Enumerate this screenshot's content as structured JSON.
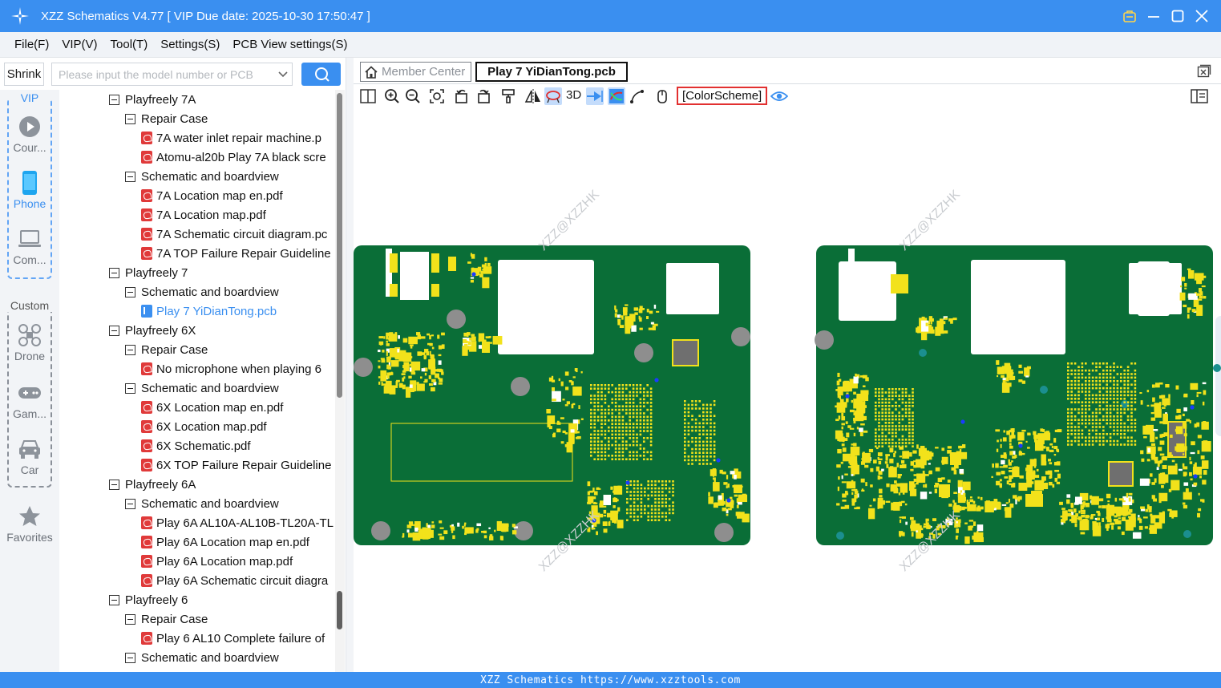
{
  "window": {
    "title": "XZZ Schematics V4.77 [ VIP Due date: 2025-10-30 17:50:47 ]"
  },
  "menu": [
    "File(F)",
    "VIP(V)",
    "Tool(T)",
    "Settings(S)",
    "PCB View settings(S)"
  ],
  "search": {
    "shrink_label": "Shrink",
    "placeholder": "Please input the model number or PCB"
  },
  "categories": {
    "vip_label": "VIP",
    "custom_label": "Custom",
    "vip_items": [
      "Cour...",
      "Phone",
      "Com..."
    ],
    "custom_items": [
      "Drone",
      "Gam...",
      "Car"
    ],
    "favorites": "Favorites"
  },
  "tree": [
    {
      "level": 0,
      "kind": "folder",
      "text": "Playfreely 7A"
    },
    {
      "level": 1,
      "kind": "folder",
      "text": "Repair Case"
    },
    {
      "level": 2,
      "kind": "pdf",
      "text": "7A water inlet repair machine.p"
    },
    {
      "level": 2,
      "kind": "pdf",
      "text": "Atomu-al20b Play 7A black scre"
    },
    {
      "level": 1,
      "kind": "folder",
      "text": "Schematic and boardview"
    },
    {
      "level": 2,
      "kind": "pdf",
      "text": "7A Location map en.pdf"
    },
    {
      "level": 2,
      "kind": "pdf",
      "text": "7A Location map.pdf"
    },
    {
      "level": 2,
      "kind": "pdf",
      "text": "7A Schematic circuit diagram.pc"
    },
    {
      "level": 2,
      "kind": "pdf",
      "text": "7A TOP Failure Repair Guideline"
    },
    {
      "level": 0,
      "kind": "folder",
      "text": "Playfreely 7"
    },
    {
      "level": 1,
      "kind": "folder",
      "text": "Schematic and boardview"
    },
    {
      "level": 2,
      "kind": "pcb",
      "text": "Play 7 YiDianTong.pcb",
      "selected": true
    },
    {
      "level": 0,
      "kind": "folder",
      "text": "Playfreely 6X"
    },
    {
      "level": 1,
      "kind": "folder",
      "text": "Repair Case"
    },
    {
      "level": 2,
      "kind": "pdf",
      "text": "No microphone when playing 6"
    },
    {
      "level": 1,
      "kind": "folder",
      "text": "Schematic and boardview"
    },
    {
      "level": 2,
      "kind": "pdf",
      "text": "6X Location map en.pdf"
    },
    {
      "level": 2,
      "kind": "pdf",
      "text": "6X Location map.pdf"
    },
    {
      "level": 2,
      "kind": "pdf",
      "text": "6X Schematic.pdf"
    },
    {
      "level": 2,
      "kind": "pdf",
      "text": "6X TOP Failure Repair Guideline"
    },
    {
      "level": 0,
      "kind": "folder",
      "text": "Playfreely 6A"
    },
    {
      "level": 1,
      "kind": "folder",
      "text": "Schematic and boardview"
    },
    {
      "level": 2,
      "kind": "pdf",
      "text": "Play 6A AL10A-AL10B-TL20A-TL"
    },
    {
      "level": 2,
      "kind": "pdf",
      "text": "Play 6A Location map en.pdf"
    },
    {
      "level": 2,
      "kind": "pdf",
      "text": "Play 6A Location map.pdf"
    },
    {
      "level": 2,
      "kind": "pdf",
      "text": "Play 6A Schematic circuit diagra"
    },
    {
      "level": 0,
      "kind": "folder",
      "text": "Playfreely 6"
    },
    {
      "level": 1,
      "kind": "folder",
      "text": "Repair Case"
    },
    {
      "level": 2,
      "kind": "pdf",
      "text": "Play 6 AL10 Complete failure of"
    },
    {
      "level": 1,
      "kind": "folder",
      "text": "Schematic and boardview"
    }
  ],
  "tabs": {
    "member": "Member Center",
    "active": "Play 7 YiDianTong.pcb"
  },
  "toolbar": {
    "three_d": "3D",
    "color_scheme": "[ColorScheme]"
  },
  "canvas": {
    "watermark": "XZZ@XZZHK",
    "board_color": "#0a6e37",
    "pad_color": "#f2e21b",
    "hole_color": "#8e8e8e"
  },
  "status": "XZZ Schematics https://www.xzztools.com",
  "colors": {
    "accent": "#3a8ff0",
    "board": "#0a6e37"
  }
}
